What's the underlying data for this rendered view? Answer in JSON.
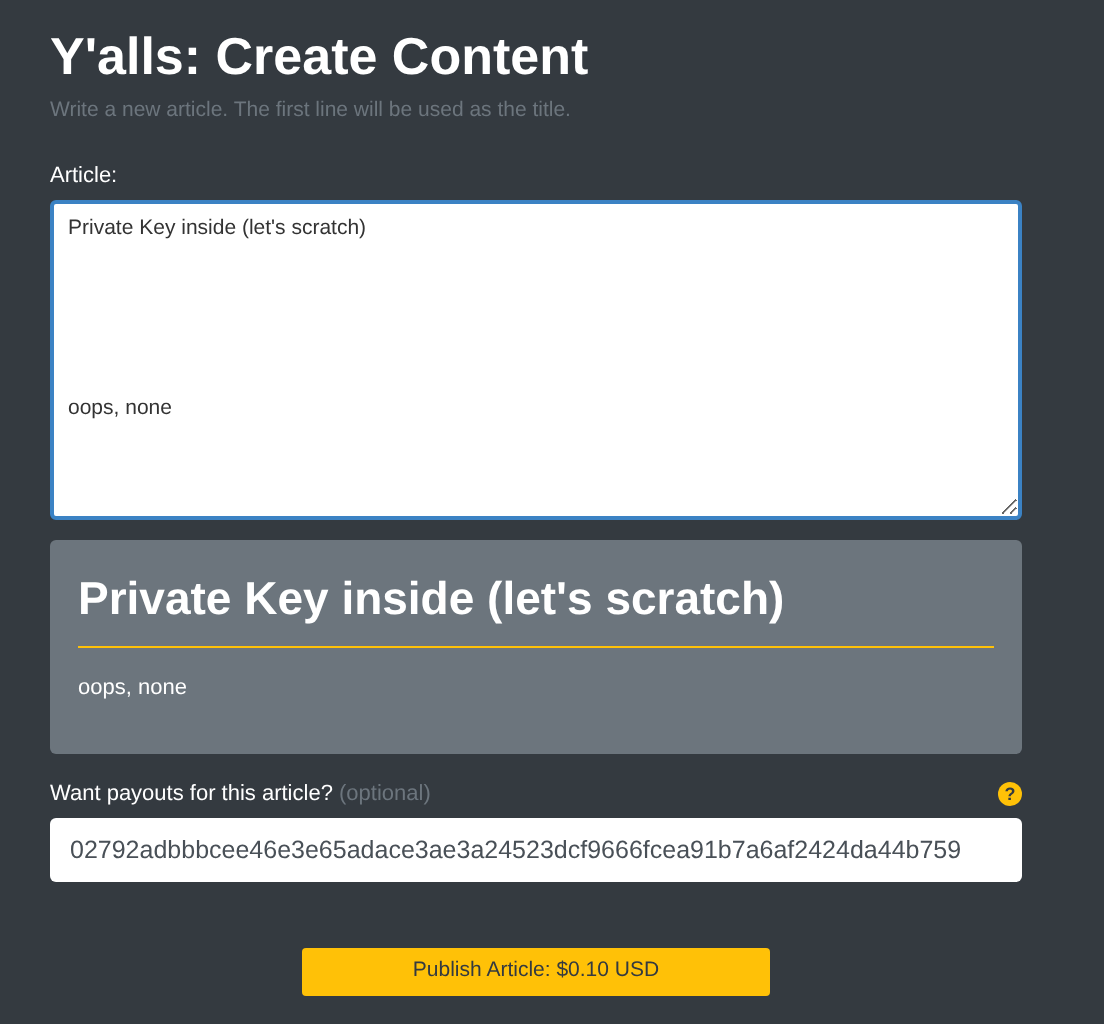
{
  "page": {
    "title": "Y'alls: Create Content",
    "subtitle": "Write a new article. The first line will be used as the title."
  },
  "article": {
    "label": "Article:",
    "value": "Private Key inside (let's scratch)\n\n\n\n\n\noops, none"
  },
  "preview": {
    "title": "Private Key inside (let's scratch)",
    "body": "oops, none"
  },
  "payouts": {
    "label": "Want payouts for this article?",
    "hint": "(optional)",
    "help": "?",
    "value": "02792adbbbcee46e3e65adace3ae3a24523dcf9666fcea91b7a6af2424da44b759"
  },
  "publish_button": "Publish Article: $0.10 USD"
}
